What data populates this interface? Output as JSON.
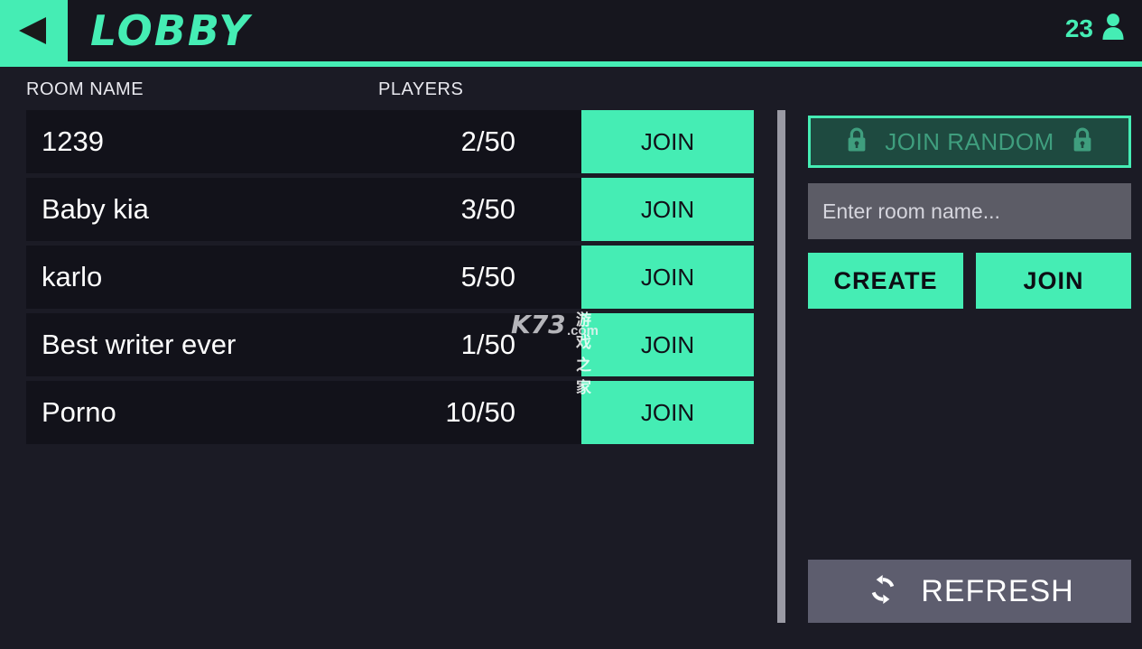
{
  "header": {
    "back_icon": "back-triangle-icon",
    "title": "LOBBY",
    "player_count": "23",
    "player_icon": "person-icon",
    "accent_color": "#45edb4",
    "background_color": "#16161e"
  },
  "table": {
    "columns": {
      "room_name": "ROOM NAME",
      "players": "PLAYERS"
    },
    "rows": [
      {
        "name": "1239",
        "players": "2/50",
        "join_label": "JOIN"
      },
      {
        "name": "Baby kia",
        "players": "3/50",
        "join_label": "JOIN"
      },
      {
        "name": "karlo",
        "players": "5/50",
        "join_label": "JOIN"
      },
      {
        "name": "Best writer ever",
        "players": "1/50",
        "join_label": "JOIN"
      },
      {
        "name": "Porno",
        "players": "10/50",
        "join_label": "JOIN"
      }
    ]
  },
  "panel": {
    "join_random_label": "JOIN RANDOM",
    "join_random_lock_icon": "lock-icon",
    "join_random_locked": true,
    "room_name_input_value": "",
    "room_name_input_placeholder": "Enter room name...",
    "create_label": "CREATE",
    "join_label": "JOIN",
    "refresh_label": "REFRESH",
    "refresh_icon": "refresh-icon",
    "refresh_color": "#5d5d6e",
    "input_color": "#5c5c66"
  },
  "watermark": {
    "brand": "K73",
    "domain": ".com",
    "tagline": "游戏之家"
  }
}
